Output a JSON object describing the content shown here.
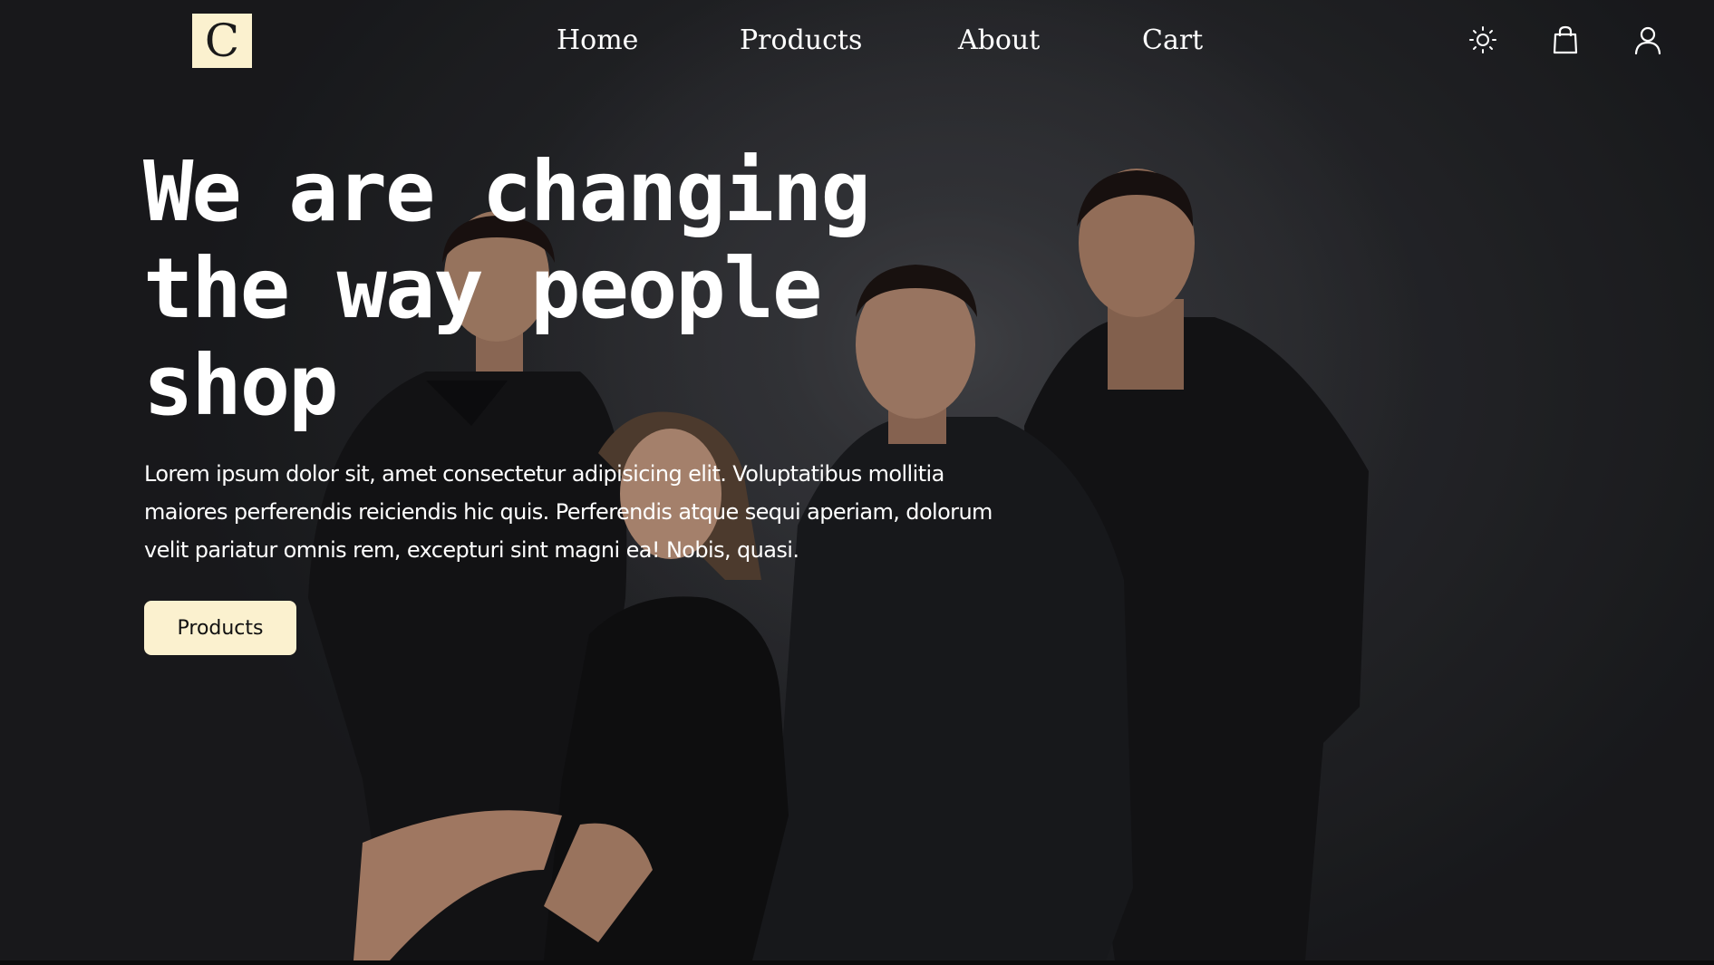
{
  "header": {
    "logo_letter": "C",
    "nav": [
      {
        "label": "Home"
      },
      {
        "label": "Products"
      },
      {
        "label": "About"
      },
      {
        "label": "Cart"
      }
    ],
    "icons": [
      "sun-icon",
      "shopping-bag-icon",
      "user-icon"
    ]
  },
  "hero": {
    "headline": "We are changing the way people shop",
    "description": "Lorem ipsum dolor sit, amet consectetur adipisicing elit. Voluptatibus mollitia maiores perferendis reiciendis hic quis. Perferendis atque sequi aperiam, dolorum velit pariatur omnis rem, excepturi sint magni ea! Nobis, quasi.",
    "cta_label": "Products",
    "image_alt": "family-photo"
  },
  "colors": {
    "accent": "#fbf1cf",
    "background": "#2a2b2f",
    "text": "#ffffff"
  }
}
